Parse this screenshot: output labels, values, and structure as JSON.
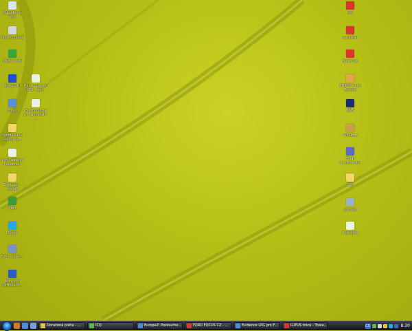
{
  "desktop": {
    "icons_left": [
      {
        "label": "Odpadkový koš",
        "icon": "recycle-bin-icon",
        "color": "#d8e4f2"
      },
      {
        "label": "Tento počítač",
        "icon": "computer-icon",
        "color": "#d0d6e0"
      },
      {
        "label": "Místa v síti",
        "icon": "network-icon",
        "color": "#38a73a"
      },
      {
        "label": "Bluetooth",
        "icon": "bluetooth-icon",
        "color": "#1e4fd0"
      },
      {
        "label": "Hamonogram LPG - zpr...",
        "icon": "document-icon",
        "color": "#e9f2e4"
      },
      {
        "label": "Fotky",
        "icon": "photos-icon",
        "color": "#5b8ed4"
      },
      {
        "label": "Harmonogram - Generáli - ...",
        "icon": "document-icon",
        "color": "#e9f2e4"
      },
      {
        "label": "Neodeslané zálohy (p...",
        "icon": "folder-icon",
        "color": "#f3d66a"
      },
      {
        "label": "Vzor-uprávky hospodaři",
        "icon": "document-icon",
        "color": "#e9f2e4"
      },
      {
        "label": "Zástupci - .zip.g5",
        "icon": "folder-icon",
        "color": "#f3d66a"
      },
      {
        "label": "Xbin",
        "icon": "excel-icon",
        "color": "#3d9b3a"
      },
      {
        "label": "Skype",
        "icon": "skype-icon",
        "color": "#2aa6e6"
      },
      {
        "label": "Fotka video...",
        "icon": "image-icon",
        "color": "#7a92c4"
      },
      {
        "label": "Koncept instrukcí C...",
        "icon": "word-icon",
        "color": "#2a5cc2"
      }
    ],
    "icons_right": [
      {
        "label": "stv",
        "icon": "vre-icon",
        "color": "#d9352d"
      },
      {
        "label": "semester",
        "icon": "vre-icon",
        "color": "#d9352d"
      },
      {
        "label": "Baserver",
        "icon": "vre-icon",
        "color": "#d9352d"
      },
      {
        "label": "EURYS trans Europe",
        "icon": "grid-icon",
        "color": "#e0a64a"
      },
      {
        "label": "ISDN",
        "icon": "java-icon",
        "color": "#1d2c6b"
      },
      {
        "label": "Winamp",
        "icon": "winamp-icon",
        "color": "#c9a04a"
      },
      {
        "label": "Total Commander",
        "icon": "floppy-icon",
        "color": "#5a6cc9"
      },
      {
        "label": "SPD",
        "icon": "folder-icon",
        "color": "#f3d66a"
      },
      {
        "label": "procesp",
        "icon": "gear-icon",
        "color": "#9fb0c9"
      },
      {
        "label": "PitstopKit",
        "icon": "document-icon",
        "color": "#e9f2e4"
      }
    ]
  },
  "taskbar": {
    "tasks": [
      {
        "label": "Doručená pošta - ...",
        "color": "#e7c24a"
      },
      {
        "label": "ICQ",
        "color": "#57b94a"
      },
      {
        "label": "EuropaZ: Poslouche...",
        "color": "#4a8ed6"
      },
      {
        "label": "FORD FOCUS CZ - ...",
        "color": "#d9352d"
      },
      {
        "label": "Evidence LPG pro F...",
        "color": "#4a8ed6"
      },
      {
        "label": "LUPUS trans - Trasa...",
        "color": "#d9352d"
      }
    ],
    "tray": {
      "lang": "CS",
      "clock": "8:30"
    }
  }
}
